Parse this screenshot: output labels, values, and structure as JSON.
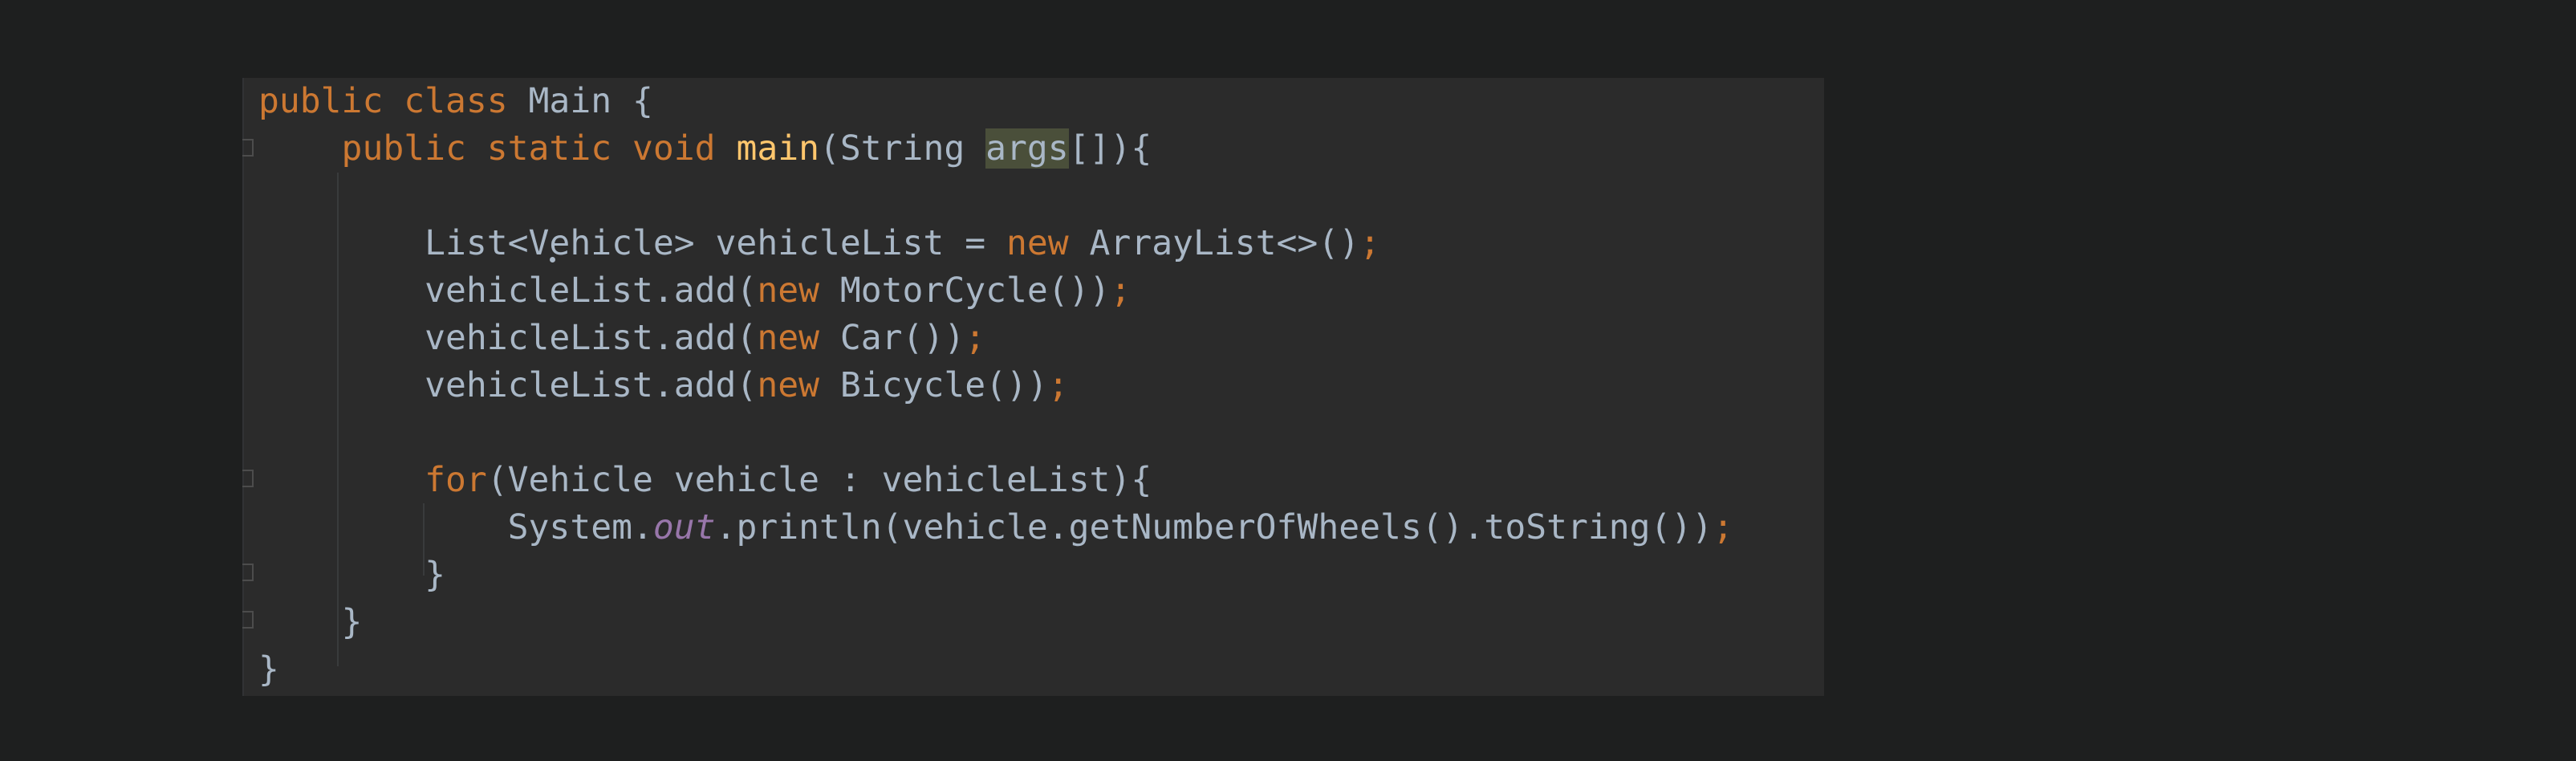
{
  "editor": {
    "lines": [
      [
        {
          "t": "public class ",
          "c": "kw"
        },
        {
          "t": "Main {",
          "c": ""
        }
      ],
      [
        {
          "t": "    public static void ",
          "c": "kw"
        },
        {
          "t": "main",
          "c": "fn"
        },
        {
          "t": "(String ",
          "c": ""
        },
        {
          "t": "args",
          "c": "sel"
        },
        {
          "t": "[]){",
          "c": ""
        }
      ],
      [],
      [
        {
          "t": "        List<Vehicle> vehicleList = ",
          "c": ""
        },
        {
          "t": "new ",
          "c": "kw"
        },
        {
          "t": "ArrayList<>()",
          "c": ""
        },
        {
          "t": ";",
          "c": "kw"
        }
      ],
      [
        {
          "t": "        vehicleList.add(",
          "c": ""
        },
        {
          "t": "new ",
          "c": "kw"
        },
        {
          "t": "MotorCycle())",
          "c": ""
        },
        {
          "t": ";",
          "c": "kw"
        }
      ],
      [
        {
          "t": "        vehicleList.add(",
          "c": ""
        },
        {
          "t": "new ",
          "c": "kw"
        },
        {
          "t": "Car())",
          "c": ""
        },
        {
          "t": ";",
          "c": "kw"
        }
      ],
      [
        {
          "t": "        vehicleList.add(",
          "c": ""
        },
        {
          "t": "new ",
          "c": "kw"
        },
        {
          "t": "Bicycle())",
          "c": ""
        },
        {
          "t": ";",
          "c": "kw"
        }
      ],
      [],
      [
        {
          "t": "        ",
          "c": ""
        },
        {
          "t": "for",
          "c": "kw"
        },
        {
          "t": "(Vehicle vehicle : vehicleList){",
          "c": ""
        }
      ],
      [
        {
          "t": "            System.",
          "c": ""
        },
        {
          "t": "out",
          "c": "field"
        },
        {
          "t": ".println(vehicle.getNumberOfWheels().toString())",
          "c": ""
        },
        {
          "t": ";",
          "c": "kw"
        }
      ],
      [
        {
          "t": "        }",
          "c": ""
        }
      ],
      [
        {
          "t": "    }",
          "c": ""
        }
      ],
      [
        {
          "t": "}",
          "c": ""
        }
      ]
    ]
  },
  "colors": {
    "background": "#1e1f1f",
    "editor_background": "#2b2b2b",
    "keyword": "#cc7832",
    "method_declaration": "#ffc66d",
    "static_field": "#9876aa",
    "default_text": "#a9b7c6",
    "selection_highlight": "#4a4f3a"
  }
}
